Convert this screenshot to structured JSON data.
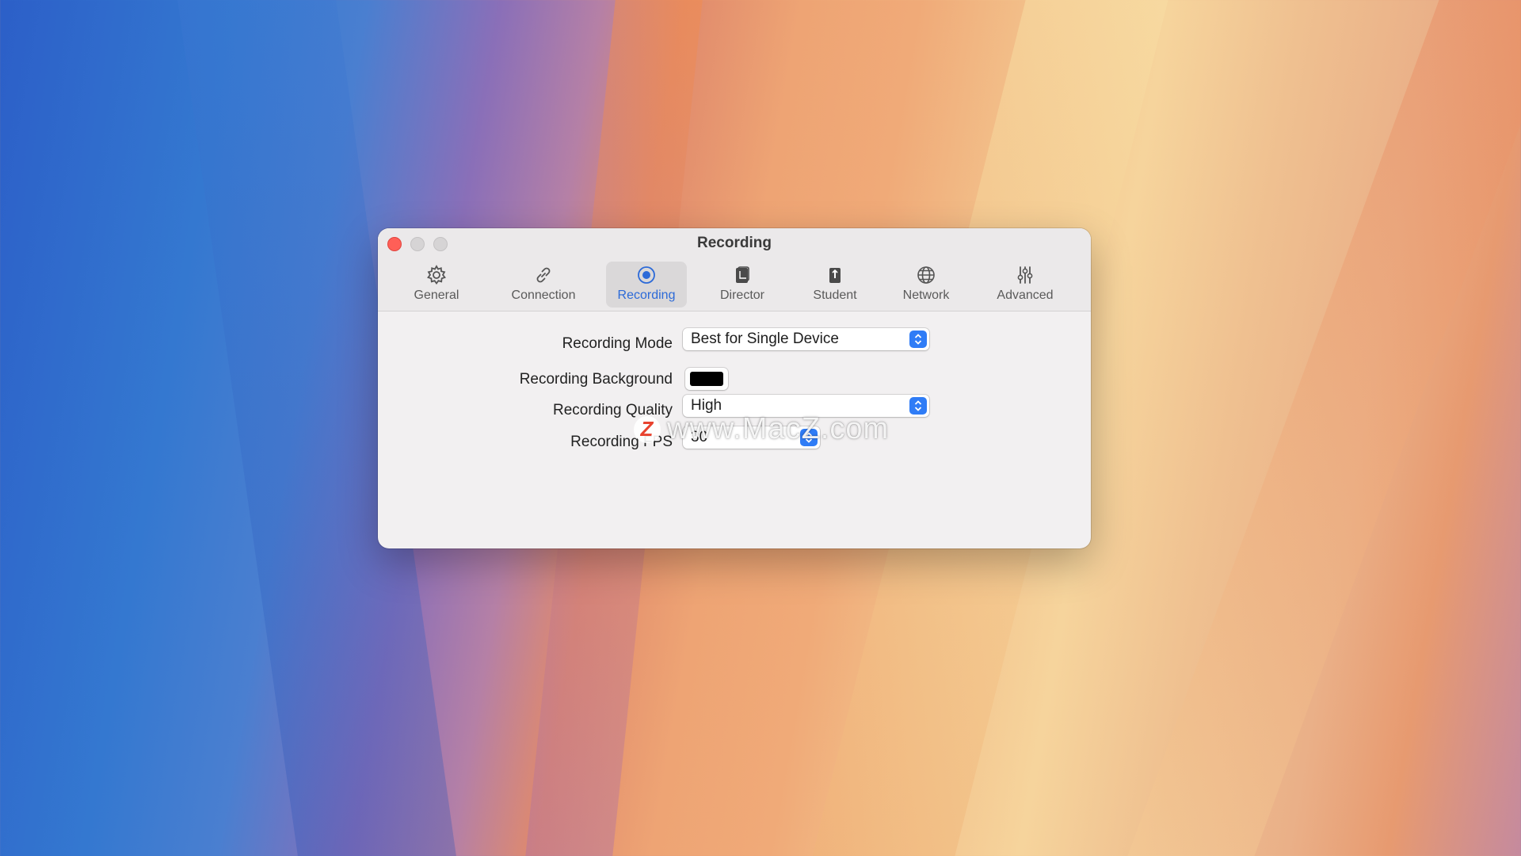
{
  "window": {
    "title": "Recording"
  },
  "tabs": [
    {
      "label": "General",
      "icon": "gear-icon"
    },
    {
      "label": "Connection",
      "icon": "link-icon"
    },
    {
      "label": "Recording",
      "icon": "record-icon",
      "active": true
    },
    {
      "label": "Director",
      "icon": "director-icon"
    },
    {
      "label": "Student",
      "icon": "student-icon"
    },
    {
      "label": "Network",
      "icon": "globe-icon"
    },
    {
      "label": "Advanced",
      "icon": "sliders-icon"
    }
  ],
  "settings": {
    "recording_mode": {
      "label": "Recording Mode",
      "value": "Best for Single Device"
    },
    "recording_background": {
      "label": "Recording Background",
      "color": "#000000"
    },
    "recording_quality": {
      "label": "Recording Quality",
      "value": "High"
    },
    "recording_fps": {
      "label": "Recording FPS",
      "value": "30"
    }
  },
  "watermark": {
    "logo": "Z",
    "text": "www.MacZ.com"
  },
  "colors": {
    "accent": "#2c6ad8",
    "close_button": "#ff5f57",
    "stepper": "#2f7cf6"
  }
}
